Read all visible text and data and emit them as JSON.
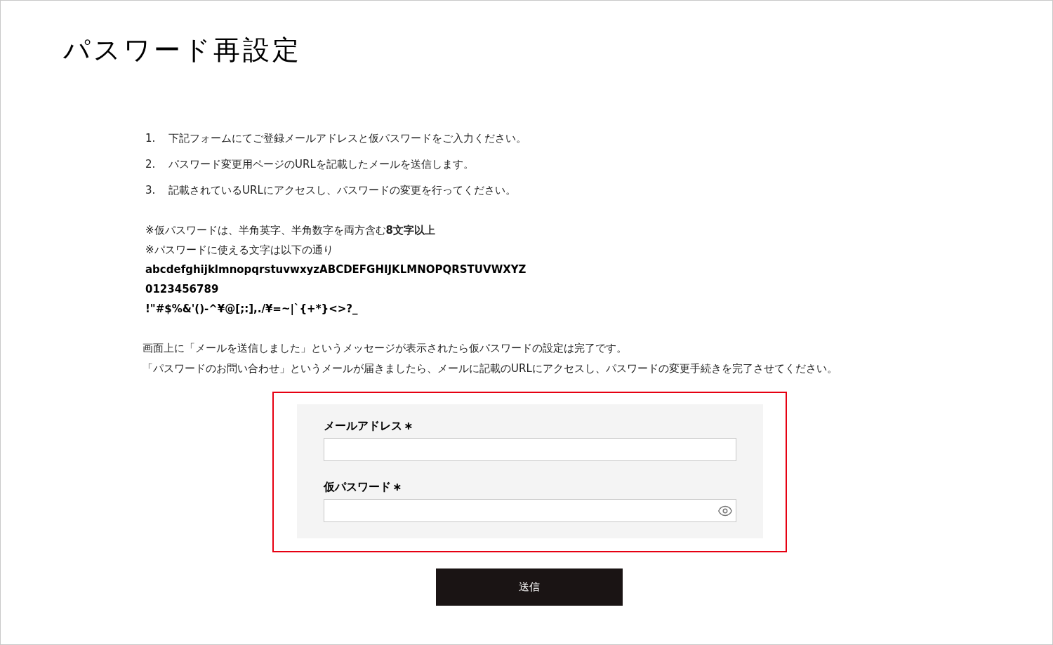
{
  "title": "パスワード再設定",
  "steps": [
    {
      "number": "1.",
      "text": "下記フォームにてご登録メールアドレスと仮パスワードをご入力ください。"
    },
    {
      "number": "2.",
      "text": "パスワード変更用ページのURLを記載したメールを送信します。"
    },
    {
      "number": "3.",
      "text": "記載されているURLにアクセスし、パスワードの変更を行ってください。"
    }
  ],
  "notes": [
    "※仮パスワードは、半角英字、半角数字を両方含む**8文字以上**",
    "※パスワードに使える文字は以下の通り"
  ],
  "allowed_characters": [
    "abcdefghijklmnopqrstuvwxyzABCDEFGHIJKLMNOPQRSTUVWXYZ",
    "0123456789",
    "!\"#$%&'()-^¥@[;:],./¥=~|`{+*}<>?_"
  ],
  "instructions": [
    "画面上に「メールを送信しました」というメッセージが表示されたら仮パスワードの設定は完了です。",
    "「パスワードのお問い合わせ」というメールが届きましたら、メールに記載のURLにアクセスし、パスワードの変更手続きを完了させてください。"
  ],
  "form": {
    "fields": [
      {
        "kind": "text",
        "label": "メールアドレス",
        "required_mark": "∗"
      },
      {
        "kind": "password",
        "label": "仮パスワード",
        "required_mark": "∗"
      }
    ]
  },
  "submit_button": "送信"
}
